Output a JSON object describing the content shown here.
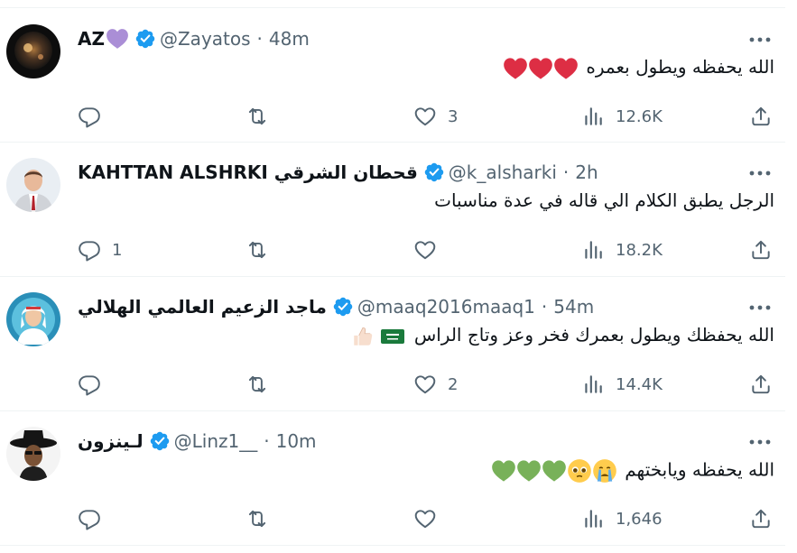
{
  "tweets": [
    {
      "name": "AZ",
      "handle": "@Zayatos",
      "time": "48m",
      "text": "الله يحفظه ويطول بعمره",
      "replies": "",
      "likes": "3",
      "views": "12.6K"
    },
    {
      "name": "KAHTTAN ALSHRKI قحطان الشرقي",
      "handle": "@k_alsharki",
      "time": "2h",
      "text": "الرجل يطبق الكلام الي قاله في عدة مناسبات",
      "replies": "1",
      "likes": "",
      "views": "18.2K"
    },
    {
      "name": "ماجد الزعيم العالمي الهلالي",
      "handle": "@maaq2016maaq1",
      "time": "54m",
      "text": "الله يحفظك ويطول بعمرك فخر وعز وتاج الراس",
      "replies": "",
      "likes": "2",
      "views": "14.4K"
    },
    {
      "name": "لـينزون",
      "handle": "@Linz1__",
      "time": "10m",
      "text": "الله يحفظه ويابختهم",
      "replies": "",
      "likes": "",
      "views": "1,646"
    }
  ],
  "separator": "·",
  "icons": [
    "verified-badge-icon",
    "more-icon",
    "reply-icon",
    "retweet-icon",
    "like-icon",
    "views-icon",
    "share-icon"
  ],
  "colors": {
    "verified": "#1d9bf0",
    "muted": "#536471",
    "divider": "#eff3f4",
    "heart": "#e0245e",
    "green_heart": "#78b159",
    "purple_heart": "#aa8ed6"
  }
}
